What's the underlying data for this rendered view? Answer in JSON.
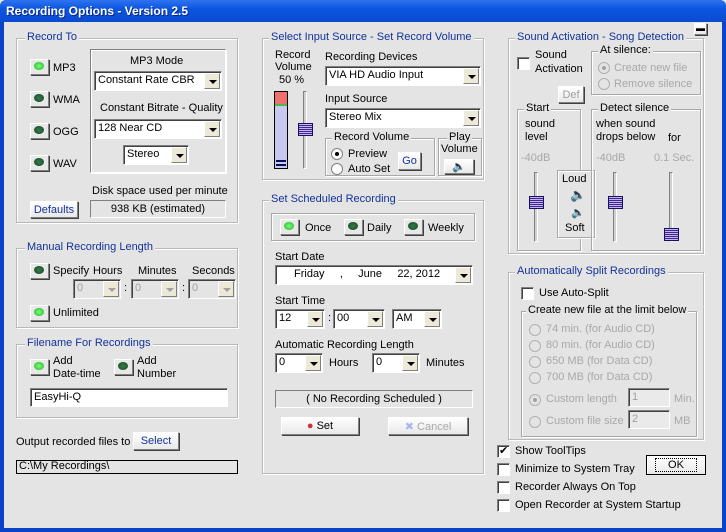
{
  "window": {
    "title": "Recording Options - Version 2.5",
    "minimize_icon": "minimize-icon"
  },
  "record_to": {
    "label": "Record To",
    "formats": [
      {
        "label": "MP3",
        "selected": true
      },
      {
        "label": "WMA",
        "selected": false
      },
      {
        "label": "OGG",
        "selected": false
      },
      {
        "label": "WAV",
        "selected": false
      }
    ],
    "mp3_mode_label": "MP3 Mode",
    "mp3_mode": "Constant Rate CBR",
    "quality_label": "Constant Bitrate - Quality",
    "quality": "128  Near CD",
    "channels": "Stereo",
    "disk_label": "Disk space used per minute",
    "disk_value": "938  KB (estimated)",
    "defaults_button": "Defaults"
  },
  "manual_length": {
    "label": "Manual Recording Length",
    "specify_label": "Specify",
    "specify_selected": false,
    "hours_label": "Hours",
    "minutes_label": "Minutes",
    "seconds_label": "Seconds",
    "hours": "0",
    "minutes": "0",
    "seconds": "0",
    "sep": ":",
    "unlimited_label": "Unlimited",
    "unlimited_selected": true
  },
  "filename": {
    "label": "Filename For Recordings",
    "add_datetime": "Add\nDate-time",
    "add_datetime_l1": "Add",
    "add_datetime_l2": "Date-time",
    "add_datetime_selected": true,
    "add_number_l1": "Add",
    "add_number_l2": "Number",
    "add_number_selected": false,
    "value": "EasyHi-Q"
  },
  "output": {
    "label": "Output recorded files to",
    "select_button": "Select",
    "path": "C:\\My Recordings\\"
  },
  "input_source": {
    "label": "Select Input Source - Set Record Volume",
    "record_volume_l1": "Record",
    "record_volume_l2": "Volume",
    "record_volume_value": "50 %",
    "record_volume_pct": 50,
    "devices_label": "Recording Devices",
    "device": "VIA HD Audio Input",
    "source_label": "Input Source",
    "source": "Stereo Mix",
    "rv_group": "Record Volume",
    "preview_label": "Preview",
    "preview_selected": true,
    "autoset_label": "Auto Set",
    "autoset_selected": false,
    "go_button": "Go",
    "play_l1": "Play",
    "play_l2": "Volume"
  },
  "schedule": {
    "label": "Set Scheduled Recording",
    "freq": [
      {
        "label": "Once",
        "selected": true
      },
      {
        "label": "Daily",
        "selected": false
      },
      {
        "label": "Weekly",
        "selected": false
      }
    ],
    "start_date_label": "Start Date",
    "start_date": "Friday     ,     June     22, 2012",
    "start_time_label": "Start Time",
    "hour": "12",
    "minute": "00",
    "ampm": "AM",
    "sep": ":",
    "auto_length_label": "Automatic Recording Length",
    "auto_hours": "0",
    "hours_label": "Hours",
    "auto_minutes": "0",
    "minutes_label": "Minutes",
    "status": "( No Recording Scheduled )",
    "set_button": "Set",
    "cancel_button": "Cancel"
  },
  "sound_activation": {
    "label": "Sound Activation - Song Detection",
    "activation_l1": "Sound",
    "activation_l2": "Activation",
    "activation_checked": false,
    "at_silence_label": "At silence:",
    "create_new_file": "Create new file",
    "create_selected": true,
    "remove_silence": "Remove silence",
    "def_button": "Def",
    "start_label": "Start",
    "start_l1": "sound",
    "start_l2": "level",
    "start_db": "-40dB",
    "loud": "Loud",
    "soft": "Soft",
    "detect_label": "Detect silence",
    "detect_l1": "when sound",
    "detect_l2": "drops below",
    "for_label": "for",
    "detect_db": "-40dB",
    "detect_sec": "0.1  Sec."
  },
  "auto_split": {
    "label": "Automatically Split Recordings",
    "use_label": "Use Auto-Split",
    "use_checked": false,
    "limit_label": "Create new file at the limit below",
    "options": [
      {
        "label": "74 min. (for Audio CD)"
      },
      {
        "label": "80 min. (for Audio CD)"
      },
      {
        "label": "650 MB (for Data CD)"
      },
      {
        "label": "700 MB (for Data CD)"
      }
    ],
    "custom_length_label": "Custom length",
    "custom_length": "1",
    "custom_length_unit": "Min.",
    "custom_length_selected": true,
    "custom_size_label": "Custom file size",
    "custom_size": "2",
    "custom_size_unit": "MB"
  },
  "options": [
    {
      "label": "Show ToolTips",
      "checked": true
    },
    {
      "label": "Minimize to System Tray",
      "checked": false
    },
    {
      "label": "Recorder Always On Top",
      "checked": false
    },
    {
      "label": "Open Recorder at System Startup",
      "checked": false
    }
  ],
  "ok_button": "OK"
}
